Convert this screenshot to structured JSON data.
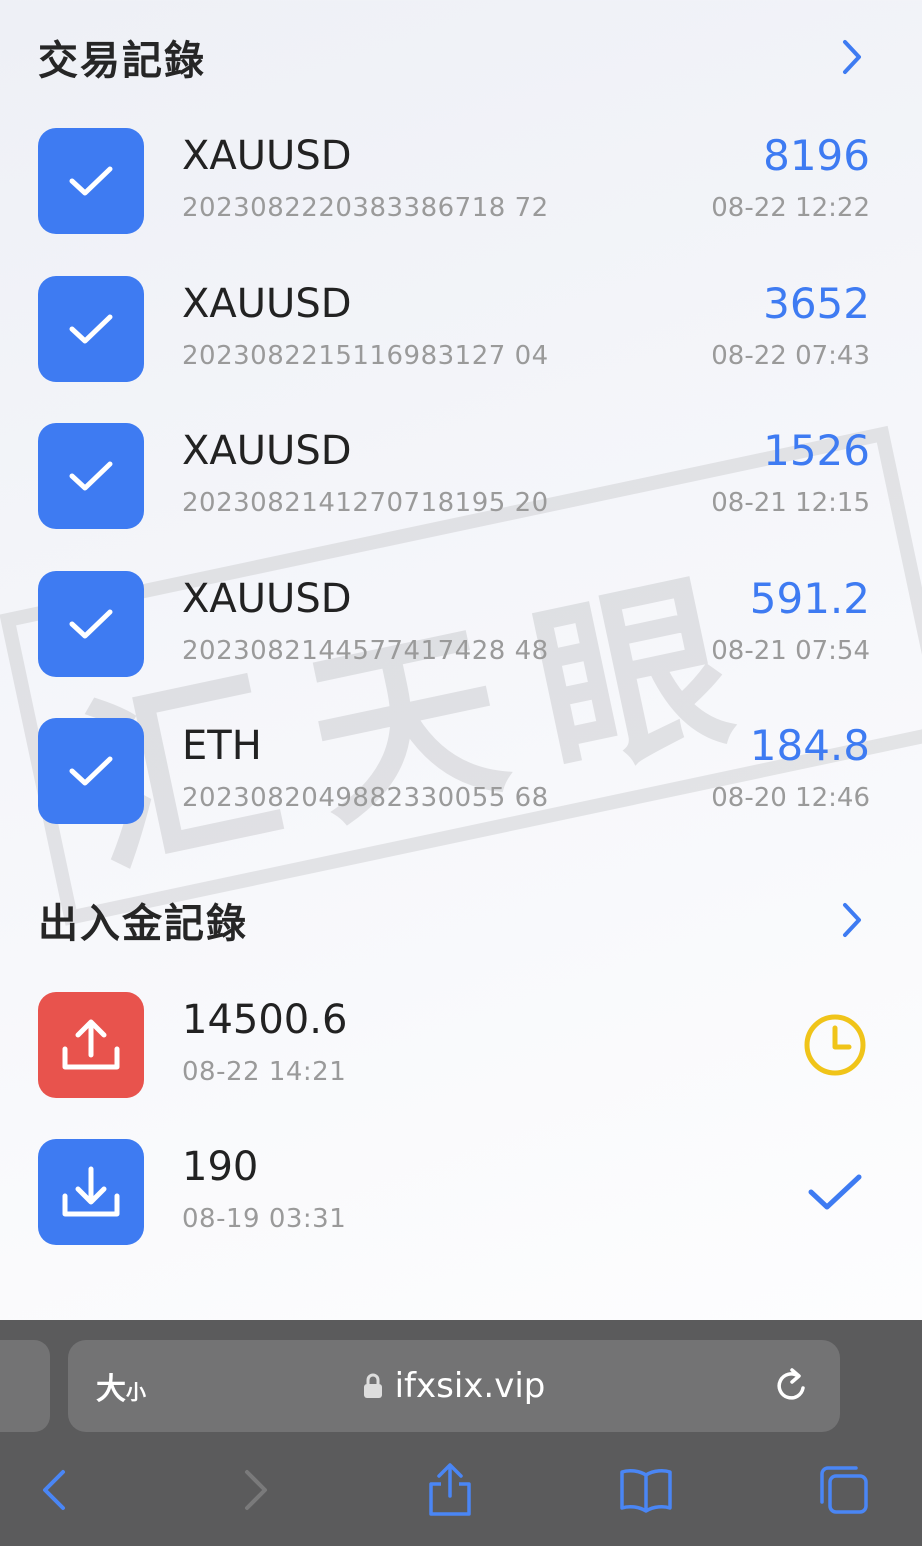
{
  "trades": {
    "title": "交易記錄",
    "items": [
      {
        "symbol": "XAUUSD",
        "id": "2023082220383386718 72",
        "amount": "8196",
        "time": "08-22 12:22"
      },
      {
        "symbol": "XAUUSD",
        "id": "2023082215116983127 04",
        "amount": "3652",
        "time": "08-22 07:43"
      },
      {
        "symbol": "XAUUSD",
        "id": "2023082141270718195 20",
        "amount": "1526",
        "time": "08-21 12:15"
      },
      {
        "symbol": "XAUUSD",
        "id": "2023082144577417428 48",
        "amount": "591.2",
        "time": "08-21 07:54"
      },
      {
        "symbol": "ETH",
        "id": "2023082049882330055 68",
        "amount": "184.8",
        "time": "08-20 12:46"
      }
    ]
  },
  "funds": {
    "title": "出入金記錄",
    "items": [
      {
        "amount": "14500.6",
        "time": "08-22 14:21",
        "type": "withdraw",
        "status": "pending",
        "tile_color": "#e8534d",
        "status_color": "#f0c419"
      },
      {
        "amount": "190",
        "time": "08-19 03:31",
        "type": "deposit",
        "status": "completed",
        "tile_color": "#3e7bf2",
        "status_color": "#3e7bf2"
      }
    ]
  },
  "watermark": {
    "text": "汇天眼"
  },
  "browser": {
    "text_size_big": "大",
    "text_size_small": "小",
    "url": "ifxsix.vip"
  },
  "colors": {
    "accent": "#3e7bf2",
    "red": "#e8534d",
    "yellow": "#f0c419"
  }
}
